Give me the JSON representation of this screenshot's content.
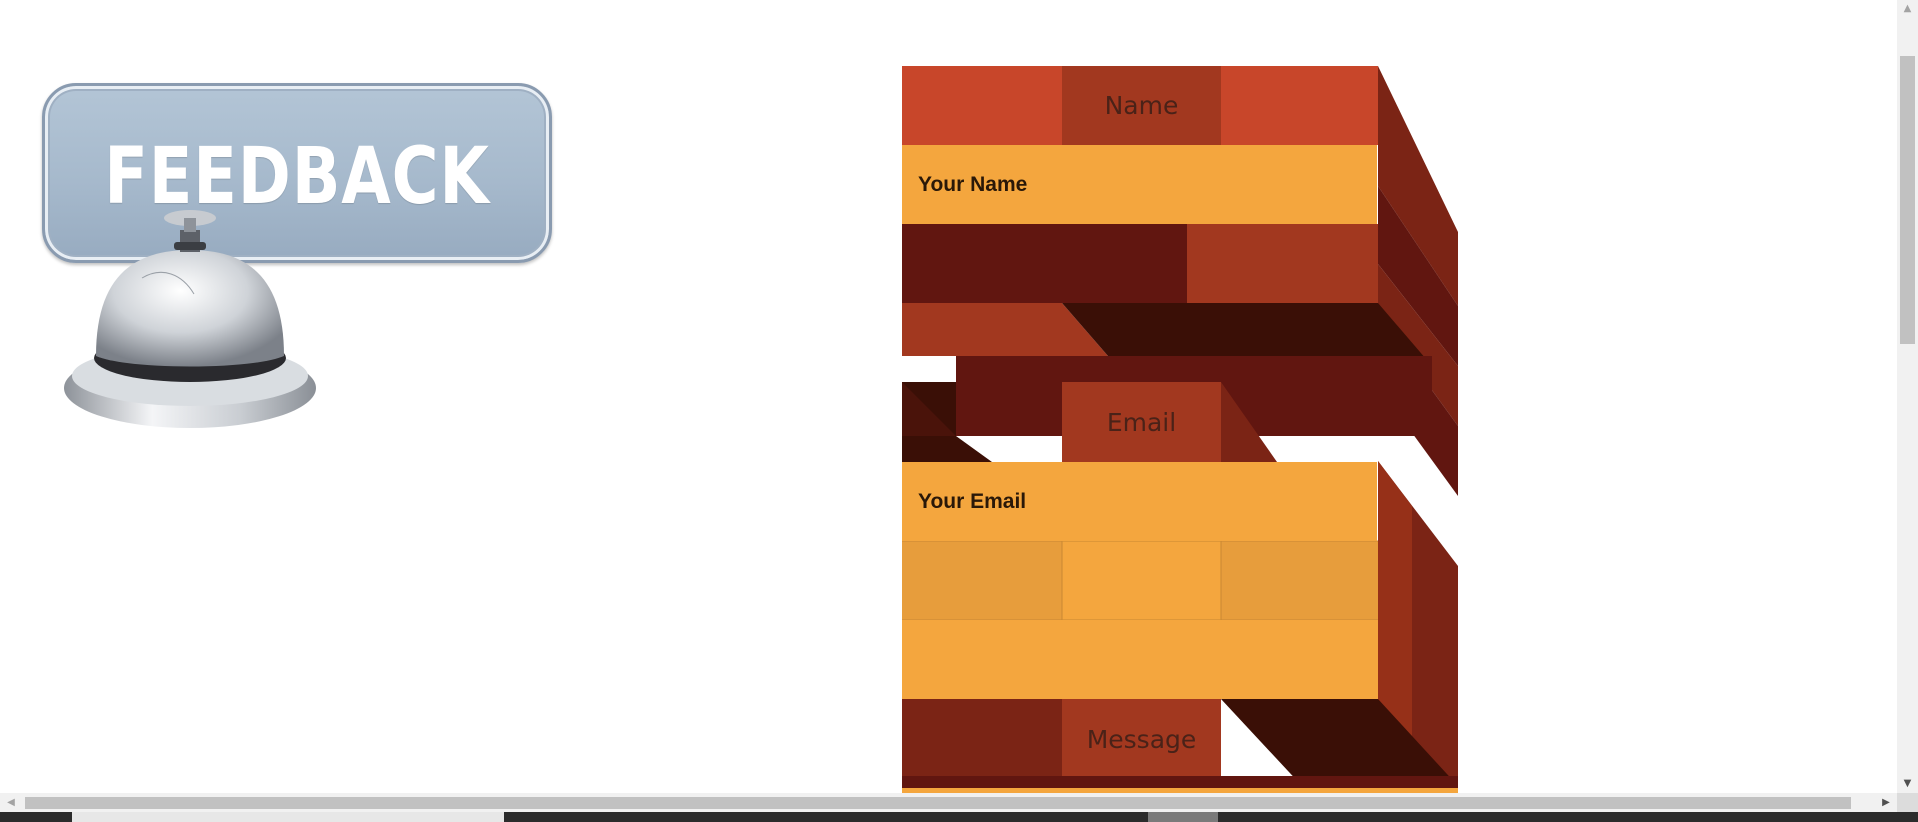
{
  "badge": {
    "title": "FEEDBACK"
  },
  "form": {
    "name_label": "Name",
    "name_placeholder": "Your Name",
    "email_label": "Email",
    "email_placeholder": "Your Email",
    "message_label": "Message"
  },
  "colors": {
    "brick_red": "#c8462a",
    "brick_mid": "#a2381f",
    "brick_dark": "#611610",
    "brick_shadow": "#3a0f06",
    "orange": "#f4a63e",
    "orange_shade": "#e79d3c"
  },
  "icons": [
    "bell-icon",
    "scroll-up-icon",
    "scroll-down-icon",
    "scroll-left-icon",
    "scroll-right-icon"
  ]
}
